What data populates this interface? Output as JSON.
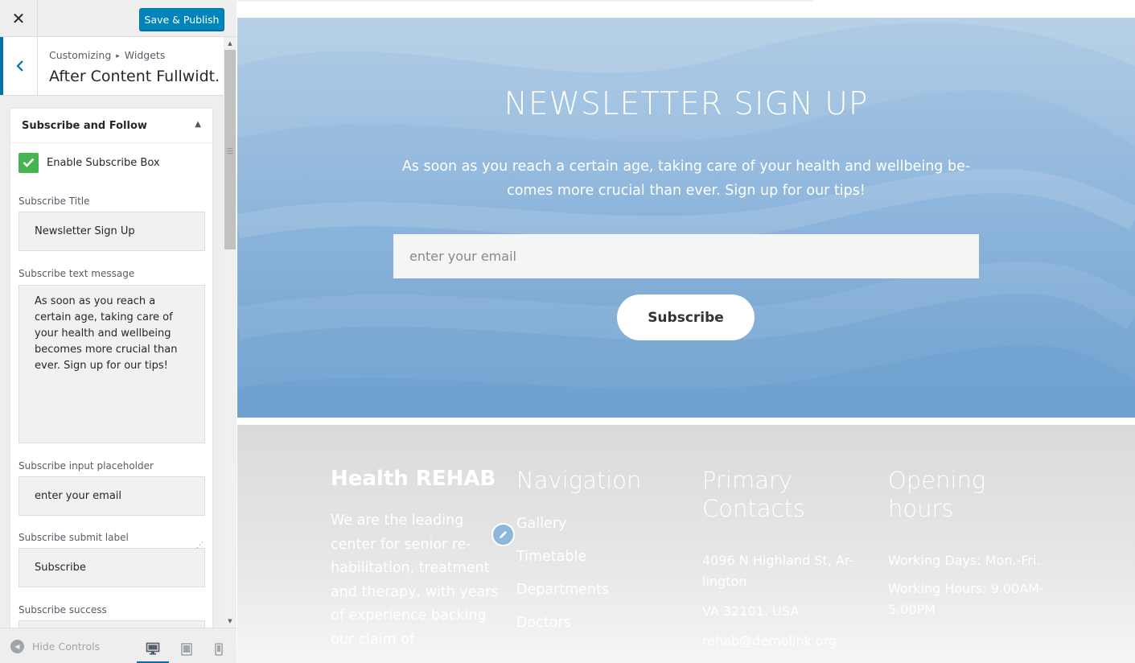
{
  "topbar": {
    "close_icon": "close-icon",
    "publish_label": "Save & Publish",
    "publish_color": "#0085ba"
  },
  "header": {
    "breadcrumb": [
      "Customizing",
      "Widgets"
    ],
    "title": "After Content Fullwidt..."
  },
  "widget": {
    "title": "Subscribe and Follow",
    "enable_label": "Enable Subscribe Box",
    "enable_checked": true,
    "fields": {
      "title_label": "Subscribe Title",
      "title_value": "Newsletter Sign Up",
      "message_label": "Subscribe text message",
      "message_value": "As soon as you reach a certain age, taking care of your health and wellbeing becomes more crucial than ever. Sign up for our tips!",
      "placeholder_label": "Subscribe input placeholder",
      "placeholder_value": "enter your email",
      "submit_label": "Subscribe submit label",
      "submit_value": "Subscribe",
      "success_label": "Subscribe success"
    }
  },
  "footer_bar": {
    "hide_controls": "Hide Controls",
    "devices": [
      "desktop",
      "tablet",
      "mobile"
    ],
    "active_device": "desktop"
  },
  "preview": {
    "newsletter": {
      "title": "NEWSLETTER SIGN UP",
      "text": "As soon as you reach a certain age, taking care of your health and wellbeing be-comes more crucial than ever. Sign up for our tips!",
      "email_placeholder": "enter your email",
      "submit": "Subscribe"
    },
    "footer": {
      "brand": "Health REHAB",
      "about": "We are the leading center for senior re-habilitation, treatment and therapy, with years of experience backing our claim of",
      "nav_heading": "Navigation",
      "nav_items": [
        "Gallery",
        "Timetable",
        "Departments",
        "Doctors"
      ],
      "contacts_heading": "Primary Contacts",
      "contacts": [
        "4096 N Highland St, Ar-lington",
        "VA 32101, USA",
        "rehab@demolink.org"
      ],
      "hours_heading": "Opening hours",
      "hours": [
        "Working Days: Mon.-Fri.",
        "Working Hours: 9.00AM-5.00PM"
      ]
    }
  },
  "colors": {
    "accent": "#0073aa",
    "checkbox": "#46b450",
    "newsletter_bg": "#7daad5"
  }
}
